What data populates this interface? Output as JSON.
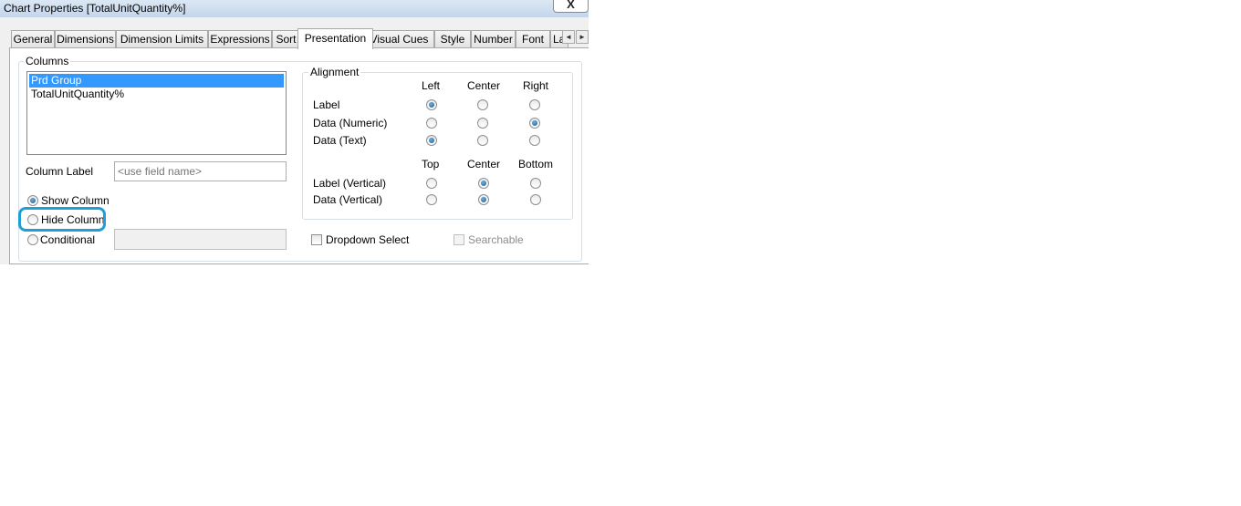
{
  "window": {
    "title": "Chart Properties [TotalUnitQuantity%]",
    "close_label": "X"
  },
  "tabs": [
    {
      "label": "General"
    },
    {
      "label": "Dimensions"
    },
    {
      "label": "Dimension Limits"
    },
    {
      "label": "Expressions"
    },
    {
      "label": "Sort"
    },
    {
      "label": "Presentation",
      "active": true
    },
    {
      "label": "Visual Cues"
    },
    {
      "label": "Style"
    },
    {
      "label": "Number"
    },
    {
      "label": "Font"
    },
    {
      "label": "La"
    }
  ],
  "tab_scroll": {
    "left": "◄",
    "right": "►"
  },
  "columns": {
    "group_label": "Columns",
    "items": [
      {
        "label": "Prd Group",
        "selected": true
      },
      {
        "label": "TotalUnitQuantity%"
      }
    ],
    "column_label": "Column Label",
    "column_label_placeholder": "<use field name>",
    "show_column": "Show Column",
    "hide_column": "Hide Column",
    "conditional": "Conditional"
  },
  "alignment": {
    "group_label": "Alignment",
    "horiz_headers": [
      "Left",
      "Center",
      "Right"
    ],
    "vert_headers": [
      "Top",
      "Center",
      "Bottom"
    ],
    "rows": [
      {
        "label": "Label",
        "selected": "Left"
      },
      {
        "label": "Data (Numeric)",
        "selected": "Right"
      },
      {
        "label": "Data (Text)",
        "selected": "Left"
      },
      {
        "label": "Label (Vertical)",
        "selected": "Center"
      },
      {
        "label": "Data (Vertical)",
        "selected": "Center"
      }
    ]
  },
  "options": {
    "dropdown_select": "Dropdown Select",
    "searchable": "Searchable"
  },
  "colors": {
    "selection": "#3399ff",
    "highlight_outline": "#1f9fd6"
  }
}
